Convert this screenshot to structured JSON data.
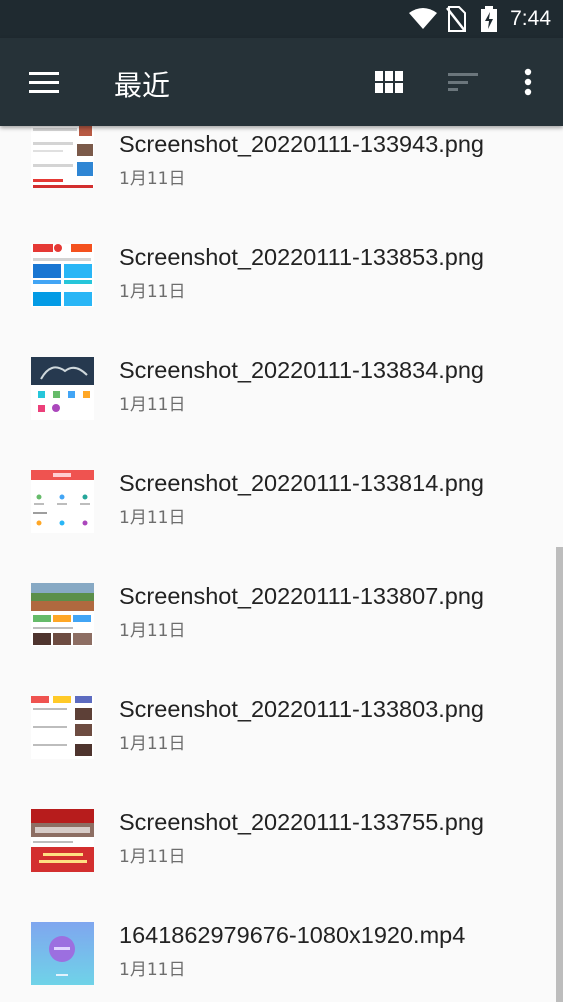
{
  "status_bar": {
    "time": "7:44",
    "icons": [
      "wifi-icon",
      "no-sim-icon",
      "battery-charging-icon"
    ]
  },
  "app_bar": {
    "title": "最近",
    "icons": [
      "menu-icon",
      "grid-view-icon",
      "sort-icon",
      "more-vert-icon"
    ]
  },
  "files": [
    {
      "name": "Screenshot_20220111-133943.png",
      "date": "1月11日",
      "thumb": "screenshot"
    },
    {
      "name": "Screenshot_20220111-133853.png",
      "date": "1月11日",
      "thumb": "screenshot"
    },
    {
      "name": "Screenshot_20220111-133834.png",
      "date": "1月11日",
      "thumb": "screenshot"
    },
    {
      "name": "Screenshot_20220111-133814.png",
      "date": "1月11日",
      "thumb": "screenshot"
    },
    {
      "name": "Screenshot_20220111-133807.png",
      "date": "1月11日",
      "thumb": "screenshot"
    },
    {
      "name": "Screenshot_20220111-133803.png",
      "date": "1月11日",
      "thumb": "screenshot"
    },
    {
      "name": "Screenshot_20220111-133755.png",
      "date": "1月11日",
      "thumb": "screenshot"
    },
    {
      "name": "1641862979676-1080x1920.mp4",
      "date": "1月11日",
      "thumb": "video"
    }
  ],
  "colors": {
    "app_bar": "#263238",
    "status_bar": "#1f2a30",
    "background": "#fafafa"
  }
}
